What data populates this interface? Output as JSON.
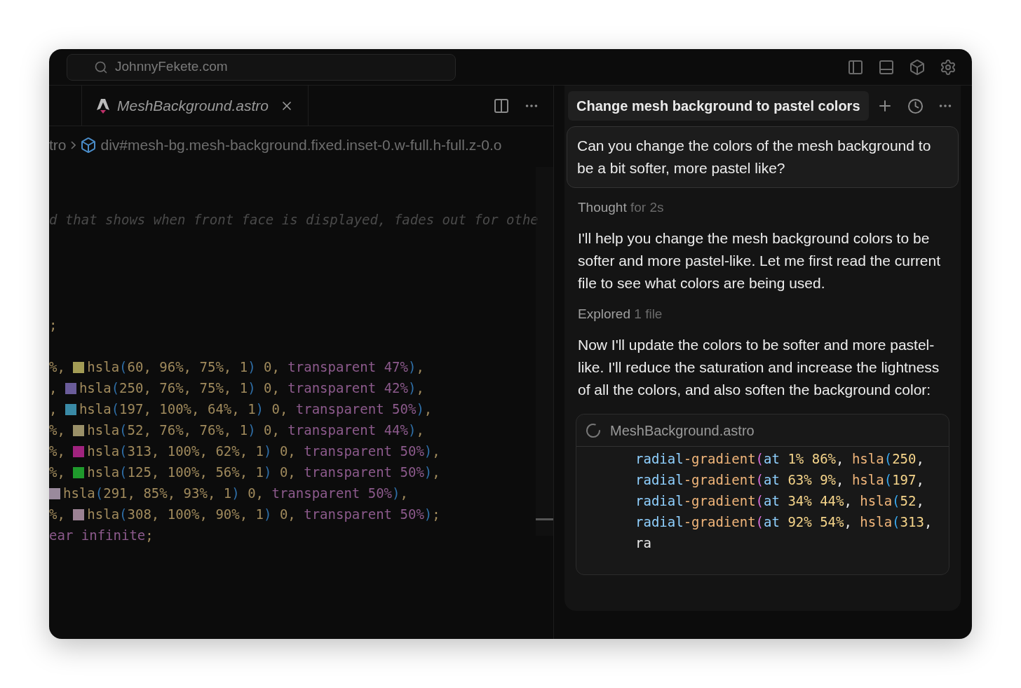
{
  "top_bar": {
    "search_value": "JohnnyFekete.com"
  },
  "editor": {
    "tab": {
      "label": "MeshBackground.astro",
      "selected": true
    },
    "breadcrumb": [
      "tro",
      "div#mesh-bg.mesh-background.fixed.inset-0.w-full.h-full.z-0.o"
    ],
    "lines": [
      {
        "kind": "blank"
      },
      {
        "kind": "blank"
      },
      {
        "kind": "code",
        "segments": [
          {
            "kind": "comment",
            "text": "d that shows when front face is displayed, fades out for othe"
          }
        ]
      },
      {
        "kind": "blank"
      },
      {
        "kind": "blank"
      },
      {
        "kind": "blank"
      },
      {
        "kind": "blank"
      },
      {
        "kind": "code",
        "segments": [
          {
            "kind": "num",
            "text": ";"
          }
        ]
      },
      {
        "kind": "blank"
      },
      {
        "kind": "code",
        "segments": [
          {
            "kind": "num",
            "text": "%, "
          },
          {
            "kind": "swatch",
            "color": "#a39c55"
          },
          {
            "kind": "num",
            "text": "hsla"
          },
          {
            "kind": "paren",
            "text": "("
          },
          {
            "kind": "num",
            "text": "60, 96%, 75%, 1"
          },
          {
            "kind": "paren",
            "text": ")"
          },
          {
            "kind": "num",
            "text": " 0, "
          },
          {
            "kind": "kw",
            "text": "transparent 47%"
          },
          {
            "kind": "paren",
            "text": ")"
          },
          {
            "kind": "num",
            "text": ","
          }
        ]
      },
      {
        "kind": "code",
        "segments": [
          {
            "kind": "num",
            "text": ", "
          },
          {
            "kind": "swatch",
            "color": "#6a5c9a"
          },
          {
            "kind": "num",
            "text": "hsla"
          },
          {
            "kind": "paren",
            "text": "("
          },
          {
            "kind": "num",
            "text": "250, 76%, 75%, 1"
          },
          {
            "kind": "paren",
            "text": ")"
          },
          {
            "kind": "num",
            "text": " 0, "
          },
          {
            "kind": "kw",
            "text": "transparent 42%"
          },
          {
            "kind": "paren",
            "text": ")"
          },
          {
            "kind": "num",
            "text": ","
          }
        ]
      },
      {
        "kind": "code",
        "segments": [
          {
            "kind": "num",
            "text": ", "
          },
          {
            "kind": "swatch",
            "color": "#3a8aa6"
          },
          {
            "kind": "num",
            "text": "hsla"
          },
          {
            "kind": "paren",
            "text": "("
          },
          {
            "kind": "num",
            "text": "197, 100%, 64%, 1"
          },
          {
            "kind": "paren",
            "text": ")"
          },
          {
            "kind": "num",
            "text": " 0, "
          },
          {
            "kind": "kw",
            "text": "transparent 50%"
          },
          {
            "kind": "paren",
            "text": ")"
          },
          {
            "kind": "num",
            "text": ","
          }
        ]
      },
      {
        "kind": "code",
        "segments": [
          {
            "kind": "num",
            "text": "%, "
          },
          {
            "kind": "swatch",
            "color": "#9a9068"
          },
          {
            "kind": "num",
            "text": "hsla"
          },
          {
            "kind": "paren",
            "text": "("
          },
          {
            "kind": "num",
            "text": "52, 76%, 76%, 1"
          },
          {
            "kind": "paren",
            "text": ")"
          },
          {
            "kind": "num",
            "text": " 0, "
          },
          {
            "kind": "kw",
            "text": "transparent 44%"
          },
          {
            "kind": "paren",
            "text": ")"
          },
          {
            "kind": "num",
            "text": ","
          }
        ]
      },
      {
        "kind": "code",
        "segments": [
          {
            "kind": "num",
            "text": "%, "
          },
          {
            "kind": "swatch",
            "color": "#a0237e"
          },
          {
            "kind": "num",
            "text": "hsla"
          },
          {
            "kind": "paren",
            "text": "("
          },
          {
            "kind": "num",
            "text": "313, 100%, 62%, 1"
          },
          {
            "kind": "paren",
            "text": ")"
          },
          {
            "kind": "num",
            "text": " 0, "
          },
          {
            "kind": "kw",
            "text": "transparent 50%"
          },
          {
            "kind": "paren",
            "text": ")"
          },
          {
            "kind": "num",
            "text": ","
          }
        ]
      },
      {
        "kind": "code",
        "segments": [
          {
            "kind": "num",
            "text": "%, "
          },
          {
            "kind": "swatch",
            "color": "#1f9a2c"
          },
          {
            "kind": "num",
            "text": "hsla"
          },
          {
            "kind": "paren",
            "text": "("
          },
          {
            "kind": "num",
            "text": "125, 100%, 56%, 1"
          },
          {
            "kind": "paren",
            "text": ")"
          },
          {
            "kind": "num",
            "text": " 0, "
          },
          {
            "kind": "kw",
            "text": "transparent 50%"
          },
          {
            "kind": "paren",
            "text": ")"
          },
          {
            "kind": "num",
            "text": ","
          }
        ]
      },
      {
        "kind": "code",
        "segments": [
          {
            "kind": "swatch",
            "color": "#9a8a9c"
          },
          {
            "kind": "num",
            "text": "hsla"
          },
          {
            "kind": "paren",
            "text": "("
          },
          {
            "kind": "num",
            "text": "291, 85%, 93%, 1"
          },
          {
            "kind": "paren",
            "text": ")"
          },
          {
            "kind": "num",
            "text": " 0, "
          },
          {
            "kind": "kw",
            "text": "transparent 50%"
          },
          {
            "kind": "paren",
            "text": ")"
          },
          {
            "kind": "num",
            "text": ","
          }
        ]
      },
      {
        "kind": "code",
        "segments": [
          {
            "kind": "num",
            "text": "%, "
          },
          {
            "kind": "swatch",
            "color": "#9c8294"
          },
          {
            "kind": "num",
            "text": "hsla"
          },
          {
            "kind": "paren",
            "text": "("
          },
          {
            "kind": "num",
            "text": "308, 100%, 90%, 1"
          },
          {
            "kind": "paren",
            "text": ")"
          },
          {
            "kind": "num",
            "text": " 0, "
          },
          {
            "kind": "kw",
            "text": "transparent 50%"
          },
          {
            "kind": "paren",
            "text": ")"
          },
          {
            "kind": "num",
            "text": ";"
          }
        ]
      },
      {
        "kind": "code",
        "segments": [
          {
            "kind": "kw",
            "text": "ear infinite"
          },
          {
            "kind": "num",
            "text": ";"
          }
        ]
      }
    ]
  },
  "chat": {
    "title": "Change mesh background to pastel colors",
    "user_message": "Can you change the colors of the mesh background to be a bit softer, more pastel like?",
    "items": [
      {
        "kind": "status",
        "label": "Thought",
        "detail": "for 2s"
      },
      {
        "kind": "text",
        "text": "I'll help you change the mesh background colors to be softer and more pastel-like. Let me first read the current file to see what colors are being used."
      },
      {
        "kind": "status",
        "label": "Explored",
        "detail": "1 file"
      },
      {
        "kind": "text",
        "text": "Now I'll update the colors to be softer and more pastel-like. I'll reduce the saturation and increase the lightness of all the colors, and also soften the background color:"
      }
    ],
    "code_block": {
      "filename": "MeshBackground.astro",
      "lines": [
        [
          {
            "kind": "fn",
            "text": "radial"
          },
          {
            "kind": "str",
            "text": "-gradient"
          },
          {
            "kind": "paren",
            "text": "("
          },
          {
            "kind": "fn",
            "text": "at "
          },
          {
            "kind": "num",
            "text": "1% 86%"
          },
          {
            "kind": "plain",
            "text": ", "
          },
          {
            "kind": "str",
            "text": "hsla"
          },
          {
            "kind": "paren2",
            "text": "("
          },
          {
            "kind": "num",
            "text": "250"
          },
          {
            "kind": "plain",
            "text": ","
          }
        ],
        [
          {
            "kind": "fn",
            "text": "radial"
          },
          {
            "kind": "str",
            "text": "-gradient"
          },
          {
            "kind": "paren",
            "text": "("
          },
          {
            "kind": "fn",
            "text": "at "
          },
          {
            "kind": "num",
            "text": "63% 9%"
          },
          {
            "kind": "plain",
            "text": ", "
          },
          {
            "kind": "str",
            "text": "hsla"
          },
          {
            "kind": "paren2",
            "text": "("
          },
          {
            "kind": "num",
            "text": "197"
          },
          {
            "kind": "plain",
            "text": ","
          }
        ],
        [
          {
            "kind": "fn",
            "text": "radial"
          },
          {
            "kind": "str",
            "text": "-gradient"
          },
          {
            "kind": "paren",
            "text": "("
          },
          {
            "kind": "fn",
            "text": "at "
          },
          {
            "kind": "num",
            "text": "34% 44%"
          },
          {
            "kind": "plain",
            "text": ", "
          },
          {
            "kind": "str",
            "text": "hsla"
          },
          {
            "kind": "paren2",
            "text": "("
          },
          {
            "kind": "num",
            "text": "52"
          },
          {
            "kind": "plain",
            "text": ","
          }
        ],
        [
          {
            "kind": "fn",
            "text": "radial"
          },
          {
            "kind": "str",
            "text": "-gradient"
          },
          {
            "kind": "paren",
            "text": "("
          },
          {
            "kind": "fn",
            "text": "at "
          },
          {
            "kind": "num",
            "text": "92% 54%"
          },
          {
            "kind": "plain",
            "text": ", "
          },
          {
            "kind": "str",
            "text": "hsla"
          },
          {
            "kind": "paren2",
            "text": "("
          },
          {
            "kind": "num",
            "text": "313"
          },
          {
            "kind": "plain",
            "text": ","
          }
        ],
        [
          {
            "kind": "plain",
            "text": "ra"
          }
        ]
      ]
    }
  }
}
